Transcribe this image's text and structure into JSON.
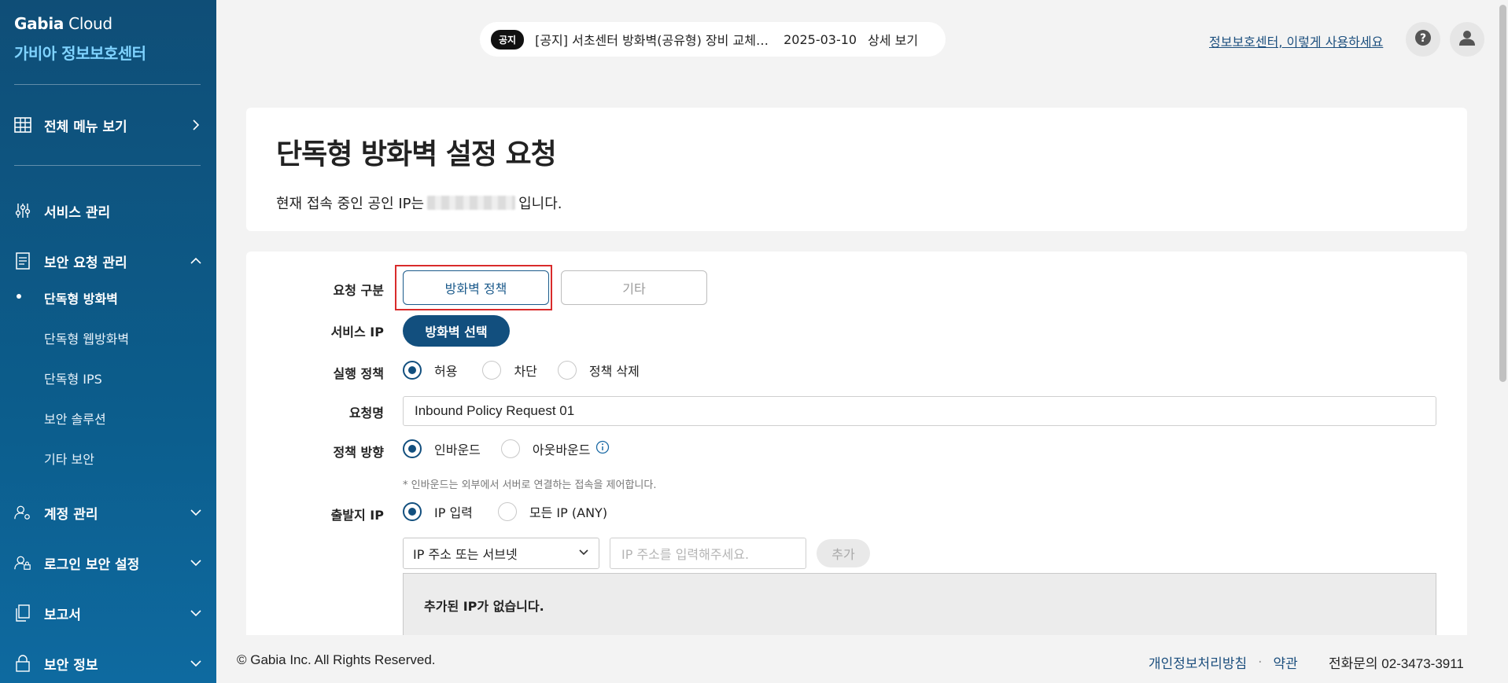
{
  "sidebar": {
    "brand_line1_bold": "Gabia",
    "brand_line1_rest": " Cloud",
    "brand_line2": "가비아 정보보호센터",
    "all_menu": "전체 메뉴 보기",
    "service_mgmt": "서비스 관리",
    "security_request": "보안 요청 관리",
    "sub_items": [
      "단독형 방화벽",
      "단독형 웹방화벽",
      "단독형 IPS",
      "보안 솔루션",
      "기타 보안"
    ],
    "account_mgmt": "계정 관리",
    "login_security": "로그인 보안 설정",
    "report": "보고서",
    "security_info": "보안 정보"
  },
  "topbar": {
    "notice_tag": "공지",
    "notice_title": "[공지] 서초센터 방화벽(공유형) 장비 교체 작업 안내",
    "notice_date": "2025-03-10",
    "notice_more": "상세 보기",
    "help_link": "정보보호센터, 이렇게 사용하세요"
  },
  "header": {
    "title": "단독형 방화벽 설정 요청",
    "ip_prefix": "현재 접속 중인 공인 IP는",
    "ip_suffix": "입니다."
  },
  "form": {
    "request_type_label": "요청 구분",
    "request_type_options": [
      "방화벽 정책",
      "기타"
    ],
    "service_ip_label": "서비스 IP",
    "service_ip_button": "방화벽 선택",
    "policy_label": "실행 정책",
    "policy_options": [
      "허용",
      "차단",
      "정책 삭제"
    ],
    "request_name_label": "요청명",
    "request_name_value": "Inbound Policy Request 01",
    "direction_label": "정책 방향",
    "direction_options": [
      "인바운드",
      "아웃바운드"
    ],
    "direction_hint": "* 인바운드는 외부에서 서버로 연결하는 접속을 제어합니다.",
    "source_ip_label": "출발지 IP",
    "source_ip_options": [
      "IP 입력",
      "모든 IP (ANY)"
    ],
    "ip_type_select": "IP 주소 또는 서브넷",
    "ip_placeholder": "IP 주소를 입력해주세요.",
    "add_button": "추가",
    "empty_message": "추가된 IP가 없습니다."
  },
  "footer": {
    "copyright": "© Gabia Inc. All Rights Reserved.",
    "privacy": "개인정보처리방침",
    "terms": "약관",
    "phone": "전화문의 02-3473-3911"
  }
}
